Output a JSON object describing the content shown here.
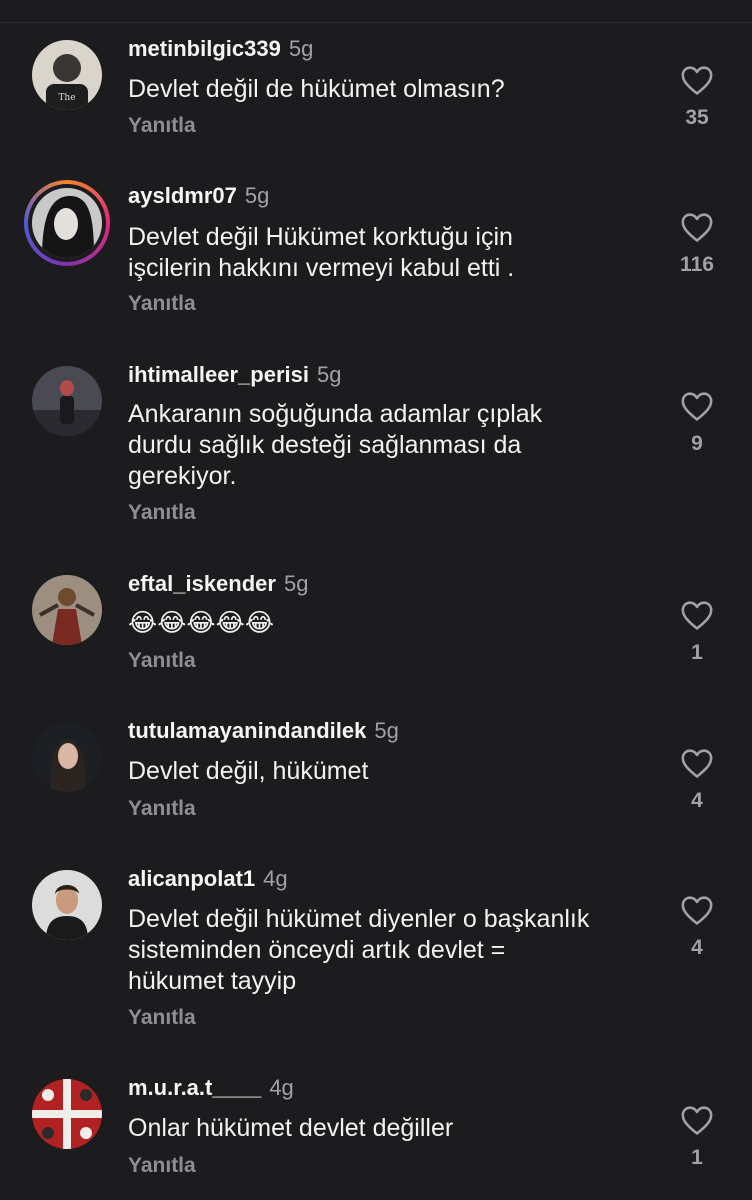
{
  "colors": {
    "background": "#1c1c1e",
    "text": "#f2f2f2",
    "muted": "#8e8e93",
    "story_ring": "#dd2a7b"
  },
  "comments": [
    {
      "username": "metinbilgic339",
      "time": "5g",
      "text": "Devlet değil de hükümet olmasın?",
      "reply": "Yanıtla",
      "likes": "35"
    },
    {
      "username": "aysldmr07",
      "time": "5g",
      "text": "Devlet değil Hükümet korktuğu için işcilerin hakkını vermeyi kabul etti .",
      "reply": "Yanıtla",
      "likes": "116"
    },
    {
      "username": "ihtimalleer_perisi",
      "time": "5g",
      "text": "Ankaranın soğuğunda adamlar çıplak durdu sağlık desteği sağlanması da gerekiyor.",
      "reply": "Yanıtla",
      "likes": "9"
    },
    {
      "username": "eftal_iskender",
      "time": "5g",
      "text": "😂😂😂😂😂",
      "reply": "Yanıtla",
      "likes": "1"
    },
    {
      "username": "tutulamayanindandilek",
      "time": "5g",
      "text": "Devlet değil, hükümet",
      "reply": "Yanıtla",
      "likes": "4"
    },
    {
      "username": "alicanpolat1",
      "time": "4g",
      "text": "Devlet değil hükümet diyenler o başkanlık sisteminden önceydi artık devlet = hükumet tayyip",
      "reply": "Yanıtla",
      "likes": "4"
    },
    {
      "username": "m.u.r.a.t____",
      "time": "4g",
      "text": "Onlar hükümet devlet değiller",
      "reply": "Yanıtla",
      "likes": "1"
    }
  ]
}
